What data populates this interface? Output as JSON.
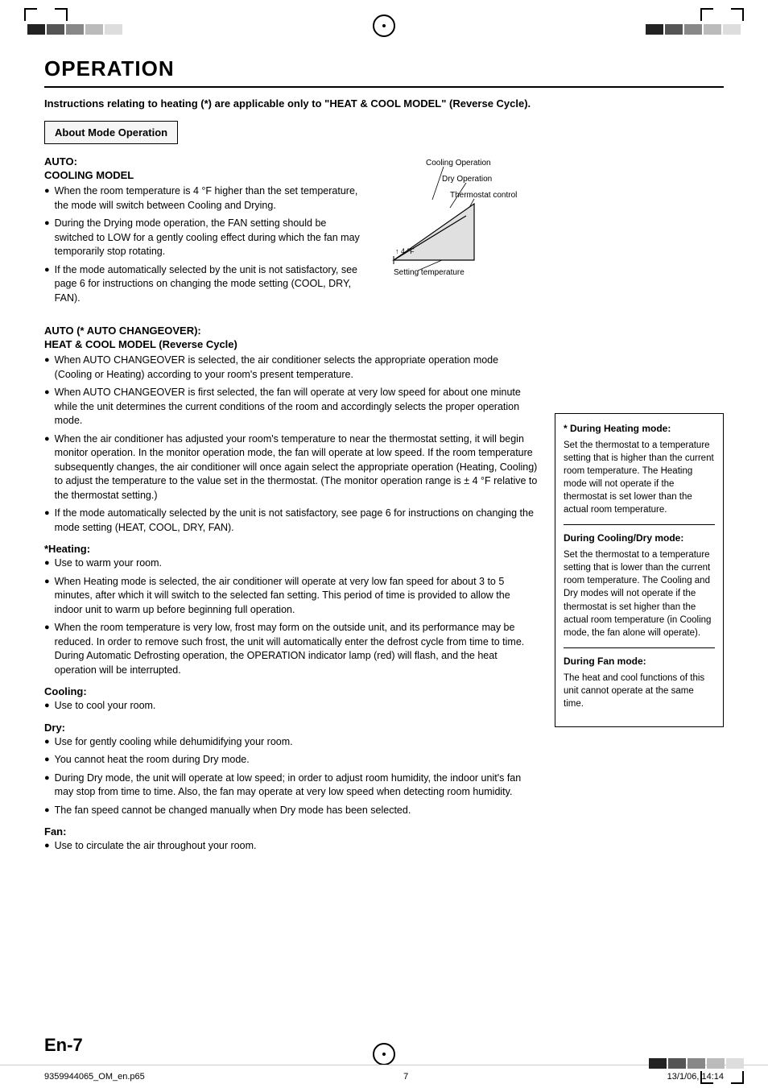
{
  "page": {
    "title": "OPERATION",
    "subtitle": "Instructions relating to heating (*) are applicable only to \"HEAT & COOL MODEL\" (Reverse Cycle).",
    "about_box_label": "About Mode Operation"
  },
  "auto_section": {
    "heading": "AUTO:",
    "subheading": "COOLING MODEL",
    "bullets": [
      "When the room temperature is 4 °F higher than the set temperature, the mode will switch between Cooling and Drying.",
      "During the Drying mode operation, the FAN setting should be switched to LOW for a gently cooling effect during which the fan may temporarily stop rotating.",
      "If the mode automatically selected by the unit is not satisfactory, see page 6 for instructions on changing the mode setting (COOL, DRY, FAN)."
    ]
  },
  "diagram": {
    "label_cooling": "Cooling Operation",
    "label_dry": "Dry Operation",
    "label_thermostat": "Thermostat control",
    "label_4f": "↑ 4 °F",
    "label_setting": "Setting temperature"
  },
  "auto_changeover_section": {
    "heading": "AUTO (* AUTO CHANGEOVER):",
    "subheading": "HEAT & COOL MODEL (Reverse Cycle)",
    "bullets": [
      "When AUTO CHANGEOVER is selected, the air conditioner selects the appropriate operation mode (Cooling or Heating) according to your room's present temperature.",
      "When AUTO CHANGEOVER is first selected, the fan will operate at very low speed for about one minute while the unit determines the current conditions of the room and accordingly selects the proper operation mode.",
      "When the air conditioner has adjusted your room's temperature to near the thermostat setting, it will begin monitor operation. In the monitor operation mode, the fan will operate at low speed. If the room temperature subsequently changes, the air conditioner will once again select the appropriate operation (Heating, Cooling) to adjust the temperature to the value set in the thermostat. (The monitor operation range is ± 4 °F relative to the thermostat setting.)",
      "If the mode automatically selected by the unit is not satisfactory, see page 6 for instructions on changing the mode setting (HEAT, COOL, DRY, FAN)."
    ]
  },
  "heating_section": {
    "heading": "*Heating:",
    "bullets": [
      "Use to warm your room.",
      "When Heating mode is selected, the air conditioner will operate at very low fan speed for about 3 to 5 minutes, after which it will switch to the selected fan setting. This period of time is provided to allow the indoor unit to warm up before beginning full operation.",
      "When the room temperature is very low, frost may form on the outside unit, and its performance may be reduced. In order to remove such frost, the unit will automatically enter the defrost cycle from time to time. During Automatic Defrosting operation, the OPERATION indicator lamp (red) will flash, and the heat operation will be interrupted."
    ]
  },
  "cooling_section": {
    "heading": "Cooling:",
    "bullets": [
      "Use to cool your room."
    ]
  },
  "dry_section": {
    "heading": "Dry:",
    "bullets": [
      "Use for gently cooling while dehumidifying your room.",
      "You cannot heat the room during Dry mode.",
      "During Dry mode, the unit will operate at low speed; in order to adjust room humidity, the indoor unit's fan may stop from time to time. Also, the fan may operate at very low speed when detecting room humidity.",
      "The fan speed cannot be changed manually when Dry mode has been selected."
    ]
  },
  "fan_section": {
    "heading": "Fan:",
    "bullets": [
      "Use to circulate the air throughout your room."
    ]
  },
  "side_box": {
    "during_heating_heading": "* During Heating mode:",
    "during_heating_text": "Set the thermostat to a temperature setting that is higher than the current room temperature. The Heating mode will not operate if the thermostat is set lower than the actual room temperature.",
    "during_cooling_heading": "During Cooling/Dry mode:",
    "during_cooling_text": "Set the thermostat to a temperature setting that is lower than the current room temperature. The Cooling and Dry modes will not operate if the thermostat is set higher than the actual room temperature (in Cooling mode, the fan alone will operate).",
    "during_fan_heading": "During Fan mode:",
    "during_fan_text": "The heat and cool functions of this unit cannot operate at the same time."
  },
  "footer": {
    "left_text": "9359944065_OM_en.p65",
    "center_text": "7",
    "right_text": "13/1/06, 14:14",
    "page_label": "En-7"
  }
}
